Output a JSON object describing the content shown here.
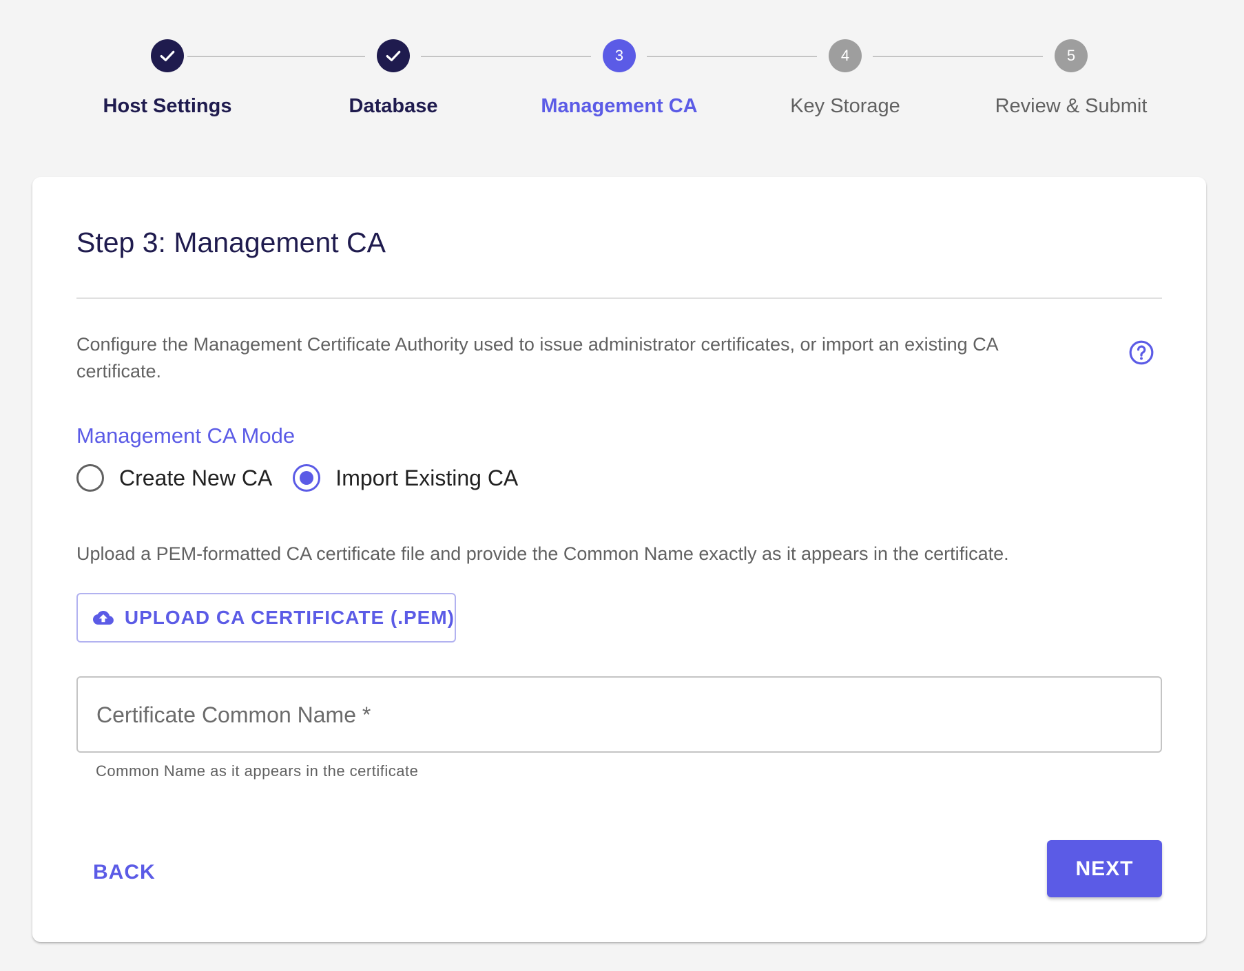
{
  "colors": {
    "primary": "#5b5be6",
    "done": "#1f1b4e",
    "pending": "#9e9e9e",
    "background": "#f4f4f4"
  },
  "stepper": {
    "steps": [
      {
        "number": "1",
        "label": "Host Settings",
        "status": "completed",
        "icon": "check-icon"
      },
      {
        "number": "2",
        "label": "Database",
        "status": "completed",
        "icon": "check-icon"
      },
      {
        "number": "3",
        "label": "Management CA",
        "status": "active"
      },
      {
        "number": "4",
        "label": "Key Storage",
        "status": "pending"
      },
      {
        "number": "5",
        "label": "Review & Submit",
        "status": "pending"
      }
    ]
  },
  "card": {
    "title": "Step 3: Management CA",
    "description": "Configure the Management Certificate Authority used to issue administrator certificates, or import an existing CA certificate.",
    "help_icon": "help-circle-icon",
    "mode": {
      "label": "Management CA Mode",
      "options": [
        {
          "label": "Create New CA",
          "selected": false
        },
        {
          "label": "Import Existing CA",
          "selected": true
        }
      ]
    },
    "instructions": "Upload a PEM-formatted CA certificate file and provide the Common Name exactly as it appears in the certificate.",
    "upload": {
      "icon": "cloud-upload-icon",
      "label": "UPLOAD CA CERTIFICATE (.PEM)"
    },
    "common_name_field": {
      "label": "Certificate Common Name *",
      "value": "",
      "helper": "Common Name as it appears in the certificate"
    },
    "actions": {
      "back_label": "BACK",
      "next_label": "NEXT"
    }
  }
}
